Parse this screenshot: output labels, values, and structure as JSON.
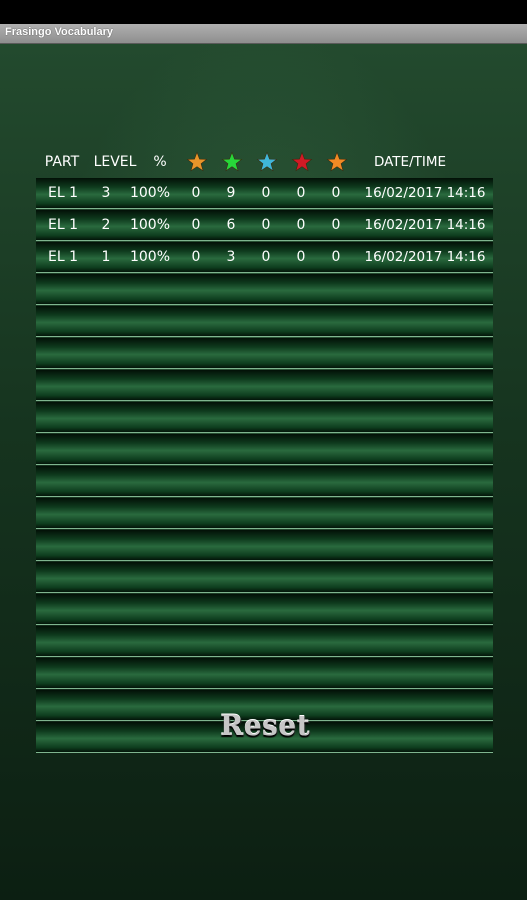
{
  "window": {
    "title": "Frasingo Vocabulary"
  },
  "table": {
    "headers": {
      "part": "PART",
      "level": "LEVEL",
      "percent": "%",
      "date_time": "DATE/TIME",
      "stars": [
        {
          "icon": "orange-star-icon",
          "color": "#e8952a"
        },
        {
          "icon": "green-star-icon",
          "color": "#27d63a"
        },
        {
          "icon": "blue-star-icon",
          "color": "#3fb7d9"
        },
        {
          "icon": "red-star-icon",
          "color": "#d11a25"
        },
        {
          "icon": "orange-star-icon",
          "color": "#f08a25"
        }
      ]
    },
    "rows": [
      {
        "part": "EL 1",
        "level": "3",
        "percent": "100%",
        "s1": "0",
        "s2": "9",
        "s3": "0",
        "s4": "0",
        "s5": "0",
        "date_time": "16/02/2017 14:16"
      },
      {
        "part": "EL 1",
        "level": "2",
        "percent": "100%",
        "s1": "0",
        "s2": "6",
        "s3": "0",
        "s4": "0",
        "s5": "0",
        "date_time": "16/02/2017 14:16"
      },
      {
        "part": "EL 1",
        "level": "1",
        "percent": "100%",
        "s1": "0",
        "s2": "3",
        "s3": "0",
        "s4": "0",
        "s5": "0",
        "date_time": "16/02/2017 14:16"
      },
      {},
      {},
      {},
      {},
      {},
      {},
      {},
      {},
      {},
      {},
      {},
      {},
      {},
      {},
      {}
    ]
  },
  "actions": {
    "reset_label": "Reset"
  },
  "colors": {
    "background": "#16341f",
    "row_line": "#7fb58f",
    "text": "#ffffff"
  }
}
